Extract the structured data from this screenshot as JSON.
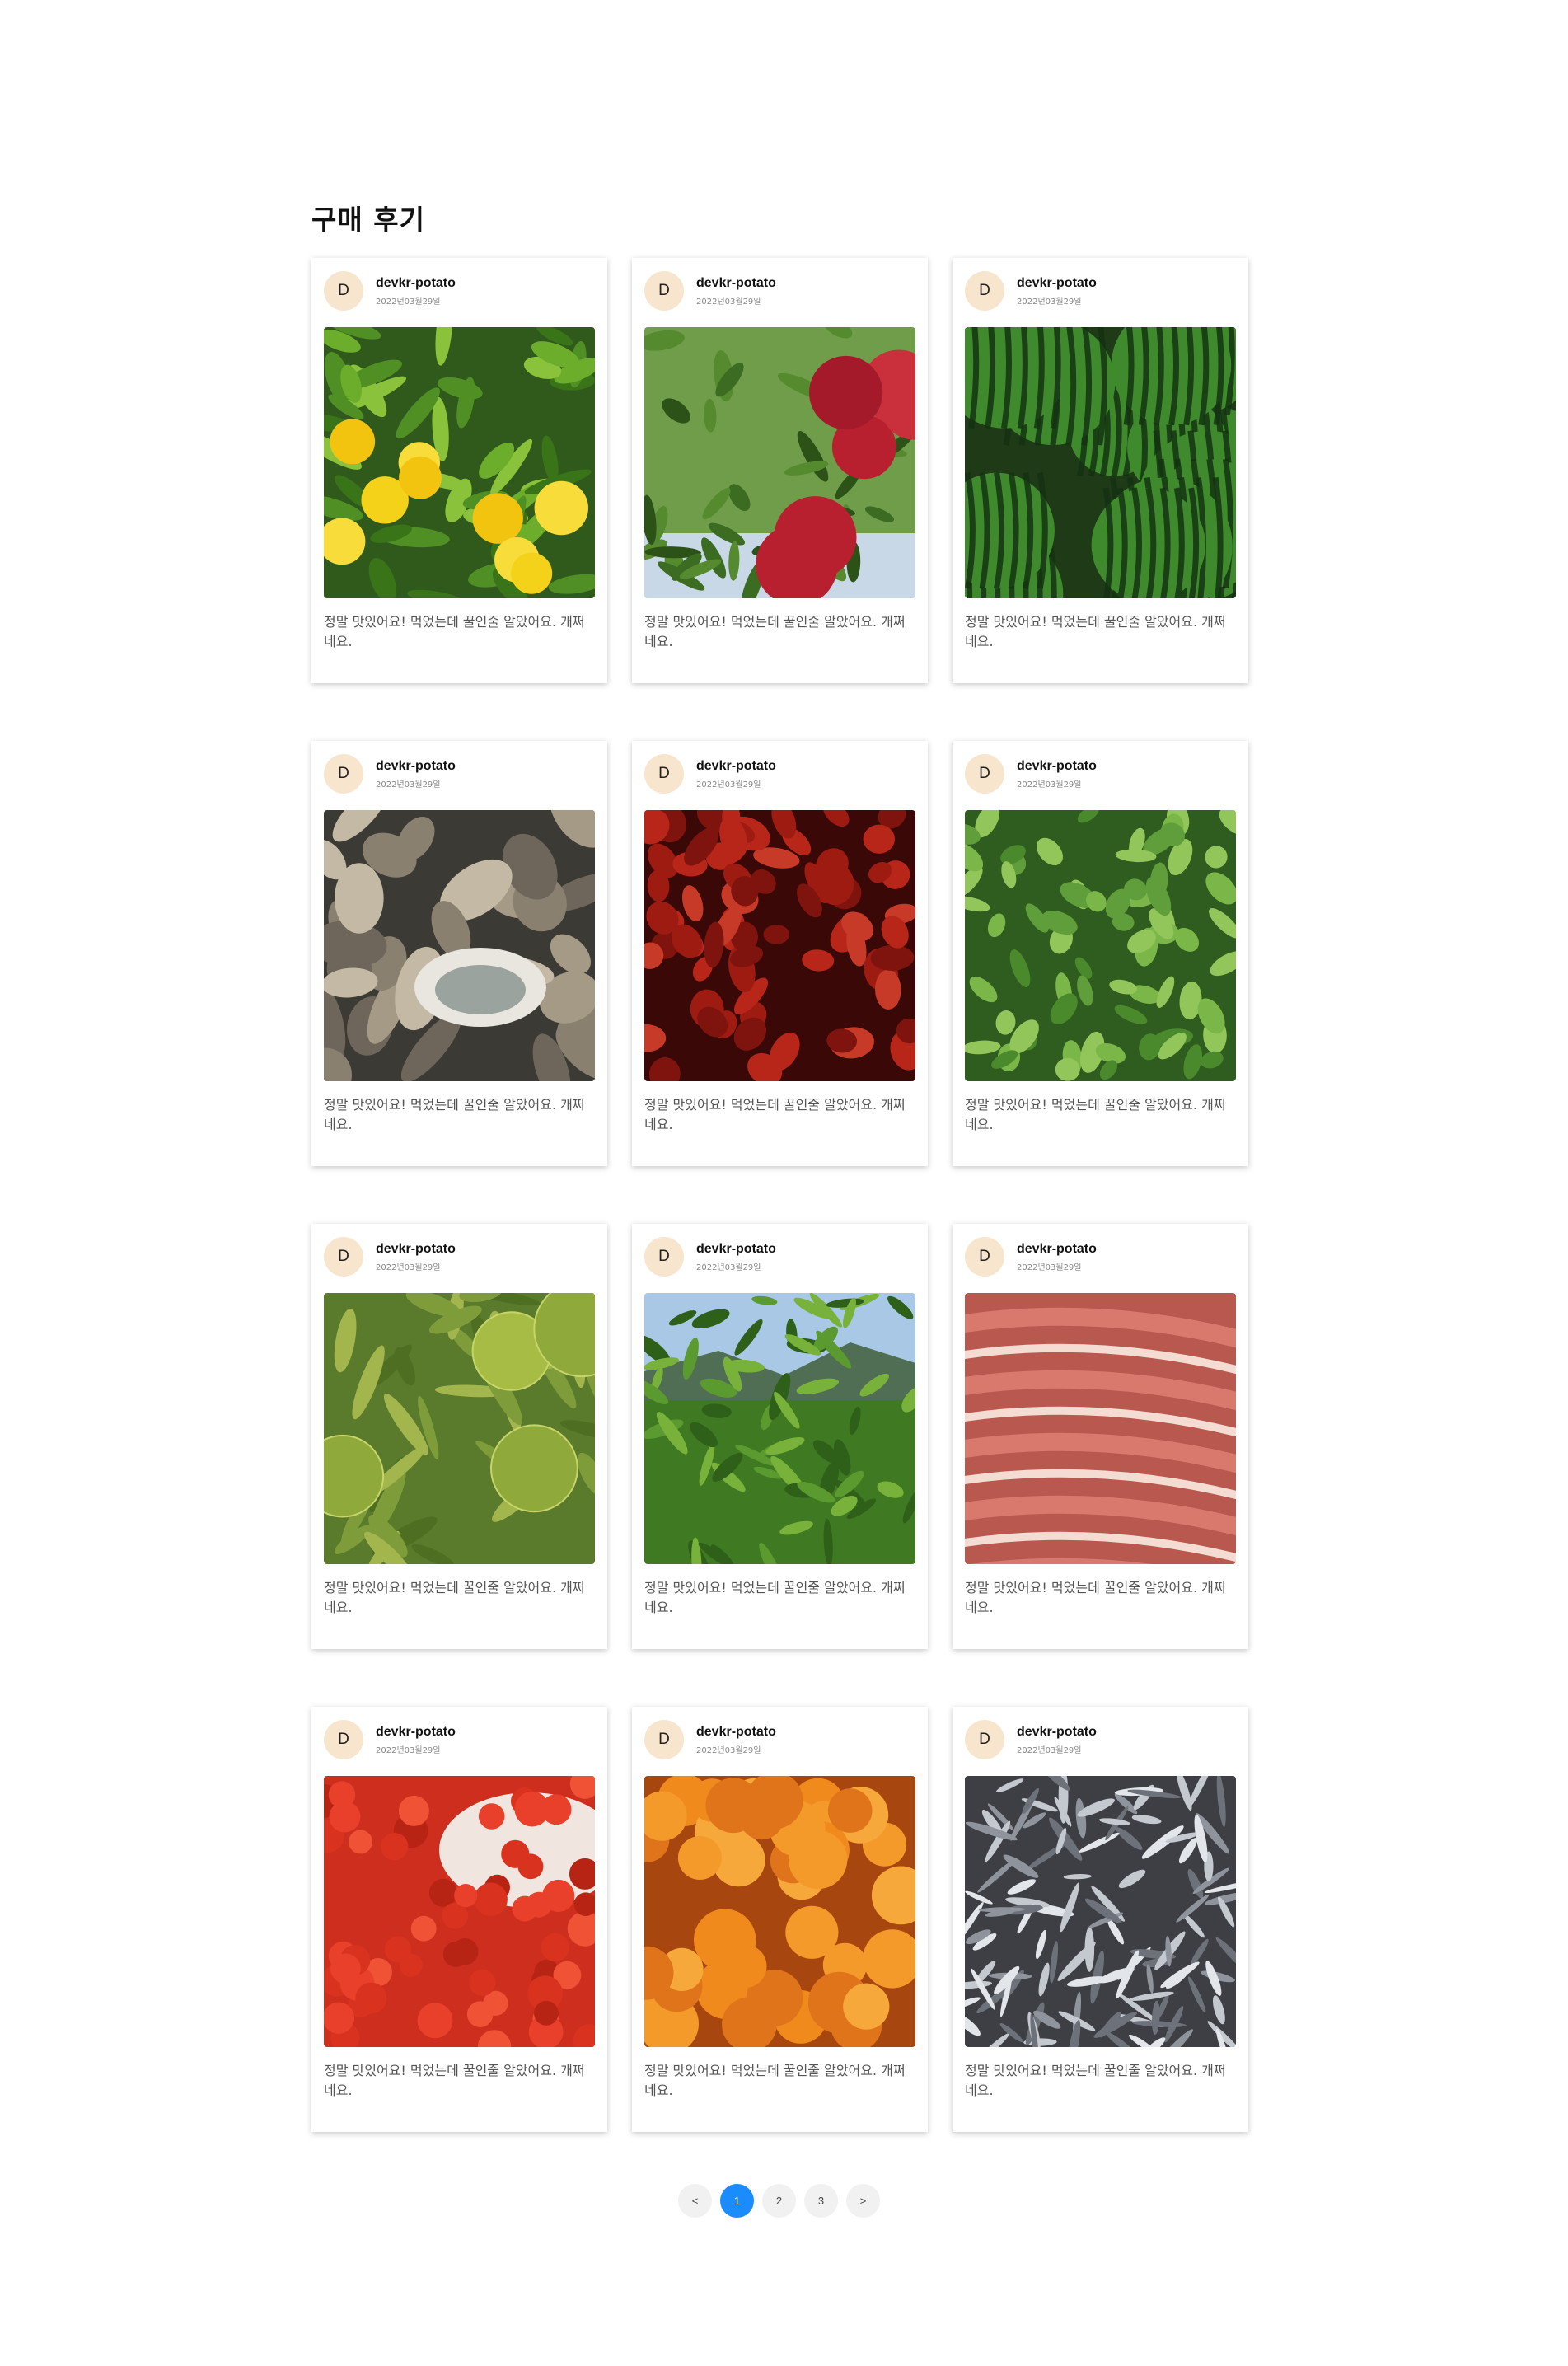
{
  "page": {
    "title": "구매 후기"
  },
  "reviews": [
    {
      "avatar": "D",
      "username": "devkr-potato",
      "date": "2022년03월29일",
      "image": "lemon-tree-photo",
      "text": "정말 맛있어요! 먹었는데 꿀인줄 알았어요. 개쩌네요."
    },
    {
      "avatar": "D",
      "username": "devkr-potato",
      "date": "2022년03월29일",
      "image": "apple-branch-photo",
      "text": "정말 맛있어요! 먹었는데 꿀인줄 알았어요. 개쩌네요."
    },
    {
      "avatar": "D",
      "username": "devkr-potato",
      "date": "2022년03월29일",
      "image": "watermelons-photo",
      "text": "정말 맛있어요! 먹었는데 꿀인줄 알았어요. 개쩌네요."
    },
    {
      "avatar": "D",
      "username": "devkr-potato",
      "date": "2022년03월29일",
      "image": "oysters-photo",
      "text": "정말 맛있어요! 먹었는데 꿀인줄 알았어요. 개쩌네요."
    },
    {
      "avatar": "D",
      "username": "devkr-potato",
      "date": "2022년03월29일",
      "image": "jujubes-photo",
      "text": "정말 맛있어요! 먹었는데 꿀인줄 알았어요. 개쩌네요."
    },
    {
      "avatar": "D",
      "username": "devkr-potato",
      "date": "2022년03월29일",
      "image": "greens-photo",
      "text": "정말 맛있어요! 먹었는데 꿀인줄 알았어요. 개쩌네요."
    },
    {
      "avatar": "D",
      "username": "devkr-potato",
      "date": "2022년03월29일",
      "image": "chestnuts-photo",
      "text": "정말 맛있어요! 먹었는데 꿀인줄 알았어요. 개쩌네요."
    },
    {
      "avatar": "D",
      "username": "devkr-potato",
      "date": "2022년03월29일",
      "image": "tea-field-photo",
      "text": "정말 맛있어요! 먹었는데 꿀인줄 알았어요. 개쩌네요."
    },
    {
      "avatar": "D",
      "username": "devkr-potato",
      "date": "2022년03월29일",
      "image": "pork-belly-photo",
      "text": "정말 맛있어요! 먹었는데 꿀인줄 알았어요. 개쩌네요."
    },
    {
      "avatar": "D",
      "username": "devkr-potato",
      "date": "2022년03월29일",
      "image": "cherry-tomatoes-photo",
      "text": "정말 맛있어요! 먹었는데 꿀인줄 알았어요. 개쩌네요."
    },
    {
      "avatar": "D",
      "username": "devkr-potato",
      "date": "2022년03월29일",
      "image": "persimmons-photo",
      "text": "정말 맛있어요! 먹었는데 꿀인줄 알았어요. 개쩌네요."
    },
    {
      "avatar": "D",
      "username": "devkr-potato",
      "date": "2022년03월29일",
      "image": "anchovies-photo",
      "text": "정말 맛있어요! 먹었는데 꿀인줄 알았어요. 개쩌네요."
    }
  ],
  "pagination": {
    "prev": "<",
    "pages": [
      "1",
      "2",
      "3"
    ],
    "active": "1",
    "next": ">"
  },
  "colors": {
    "accent": "#1a8cff",
    "avatar_bg": "#f8e5cd"
  }
}
